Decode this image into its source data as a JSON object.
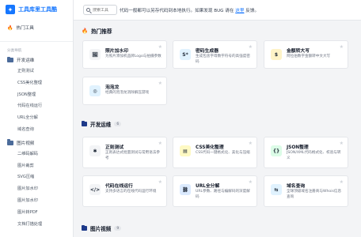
{
  "brand": {
    "title": "工具库里工具酷"
  },
  "sidebar": {
    "hot": "热门工具",
    "section_label": "分类导航",
    "categories": [
      {
        "label": "开发运维",
        "items": [
          "正则测试",
          "CSS美化整理",
          "JSON整理",
          "代码在线运行",
          "URL全分解",
          "域名查询"
        ]
      },
      {
        "label": "图片视频",
        "items": [
          "二维码解码",
          "图片裁剪",
          "SVG压缩",
          "图片加水印",
          "图片加水印",
          "图片转PDF",
          "文档打描处理"
        ]
      }
    ]
  },
  "topbar": {
    "search_placeholder": "搜索工具",
    "notice_prefix": "代码一般都可以另存代码到本地执行。如果发现 BUG 请在",
    "notice_link": "这里",
    "notice_suffix": "反馈。"
  },
  "sections": {
    "hot": {
      "title": "热门推荐"
    },
    "dev": {
      "title": "开发运维",
      "count": "6"
    },
    "media": {
      "title": "图片视频",
      "count": "9"
    }
  },
  "hot_cards": [
    {
      "title": "照片加水印",
      "desc": "为照片添加机品牌Logo与拍摄参数",
      "icon": "image-watermark-icon",
      "glyph": "🖼",
      "color": "#f3f4f6"
    },
    {
      "title": "密码生成器",
      "desc": "生成包含字母数字符号的高强度密码",
      "icon": "password-icon",
      "glyph": "S*",
      "color": "#e0f2fe"
    },
    {
      "title": "金额转大写",
      "desc": "阿拉伯数字金额转中文大写",
      "icon": "money-bag-icon",
      "glyph": "$",
      "color": "#fef3c7"
    },
    {
      "title": "泡泡龙",
      "desc": "经典的泡泡龙消除解压游戏",
      "icon": "bubble-game-icon",
      "glyph": "◎",
      "color": "#e0f2fe"
    }
  ],
  "dev_cards": [
    {
      "title": "正则测试",
      "desc": "正则表达式批量测试与常用语法参考",
      "icon": "regex-icon",
      "glyph": "✱",
      "color": "#f3f4f6"
    },
    {
      "title": "CSS美化整理",
      "desc": "CSS代码一键格式化、美化与压缩",
      "icon": "css-icon",
      "glyph": "▤",
      "color": "#fef9c3"
    },
    {
      "title": "JSON整理",
      "desc": "JSON/XML代码格式化、校验与转义",
      "icon": "json-icon",
      "glyph": "{}",
      "color": "#dcfce7"
    },
    {
      "title": "代码在线运行",
      "desc": "支持多语言的在线代码运行环境",
      "icon": "code-run-icon",
      "glyph": "</>",
      "color": "#f3f4f6"
    },
    {
      "title": "URL全分解",
      "desc": "URL参数、路径与编解码的深度解码",
      "icon": "url-link-icon",
      "glyph": "⛓",
      "color": "#dbeafe"
    },
    {
      "title": "域名查询",
      "desc": "全球顶级域名注册商与Whois信息查询",
      "icon": "domain-icon",
      "glyph": "⇆",
      "color": "#e0f2fe"
    }
  ]
}
